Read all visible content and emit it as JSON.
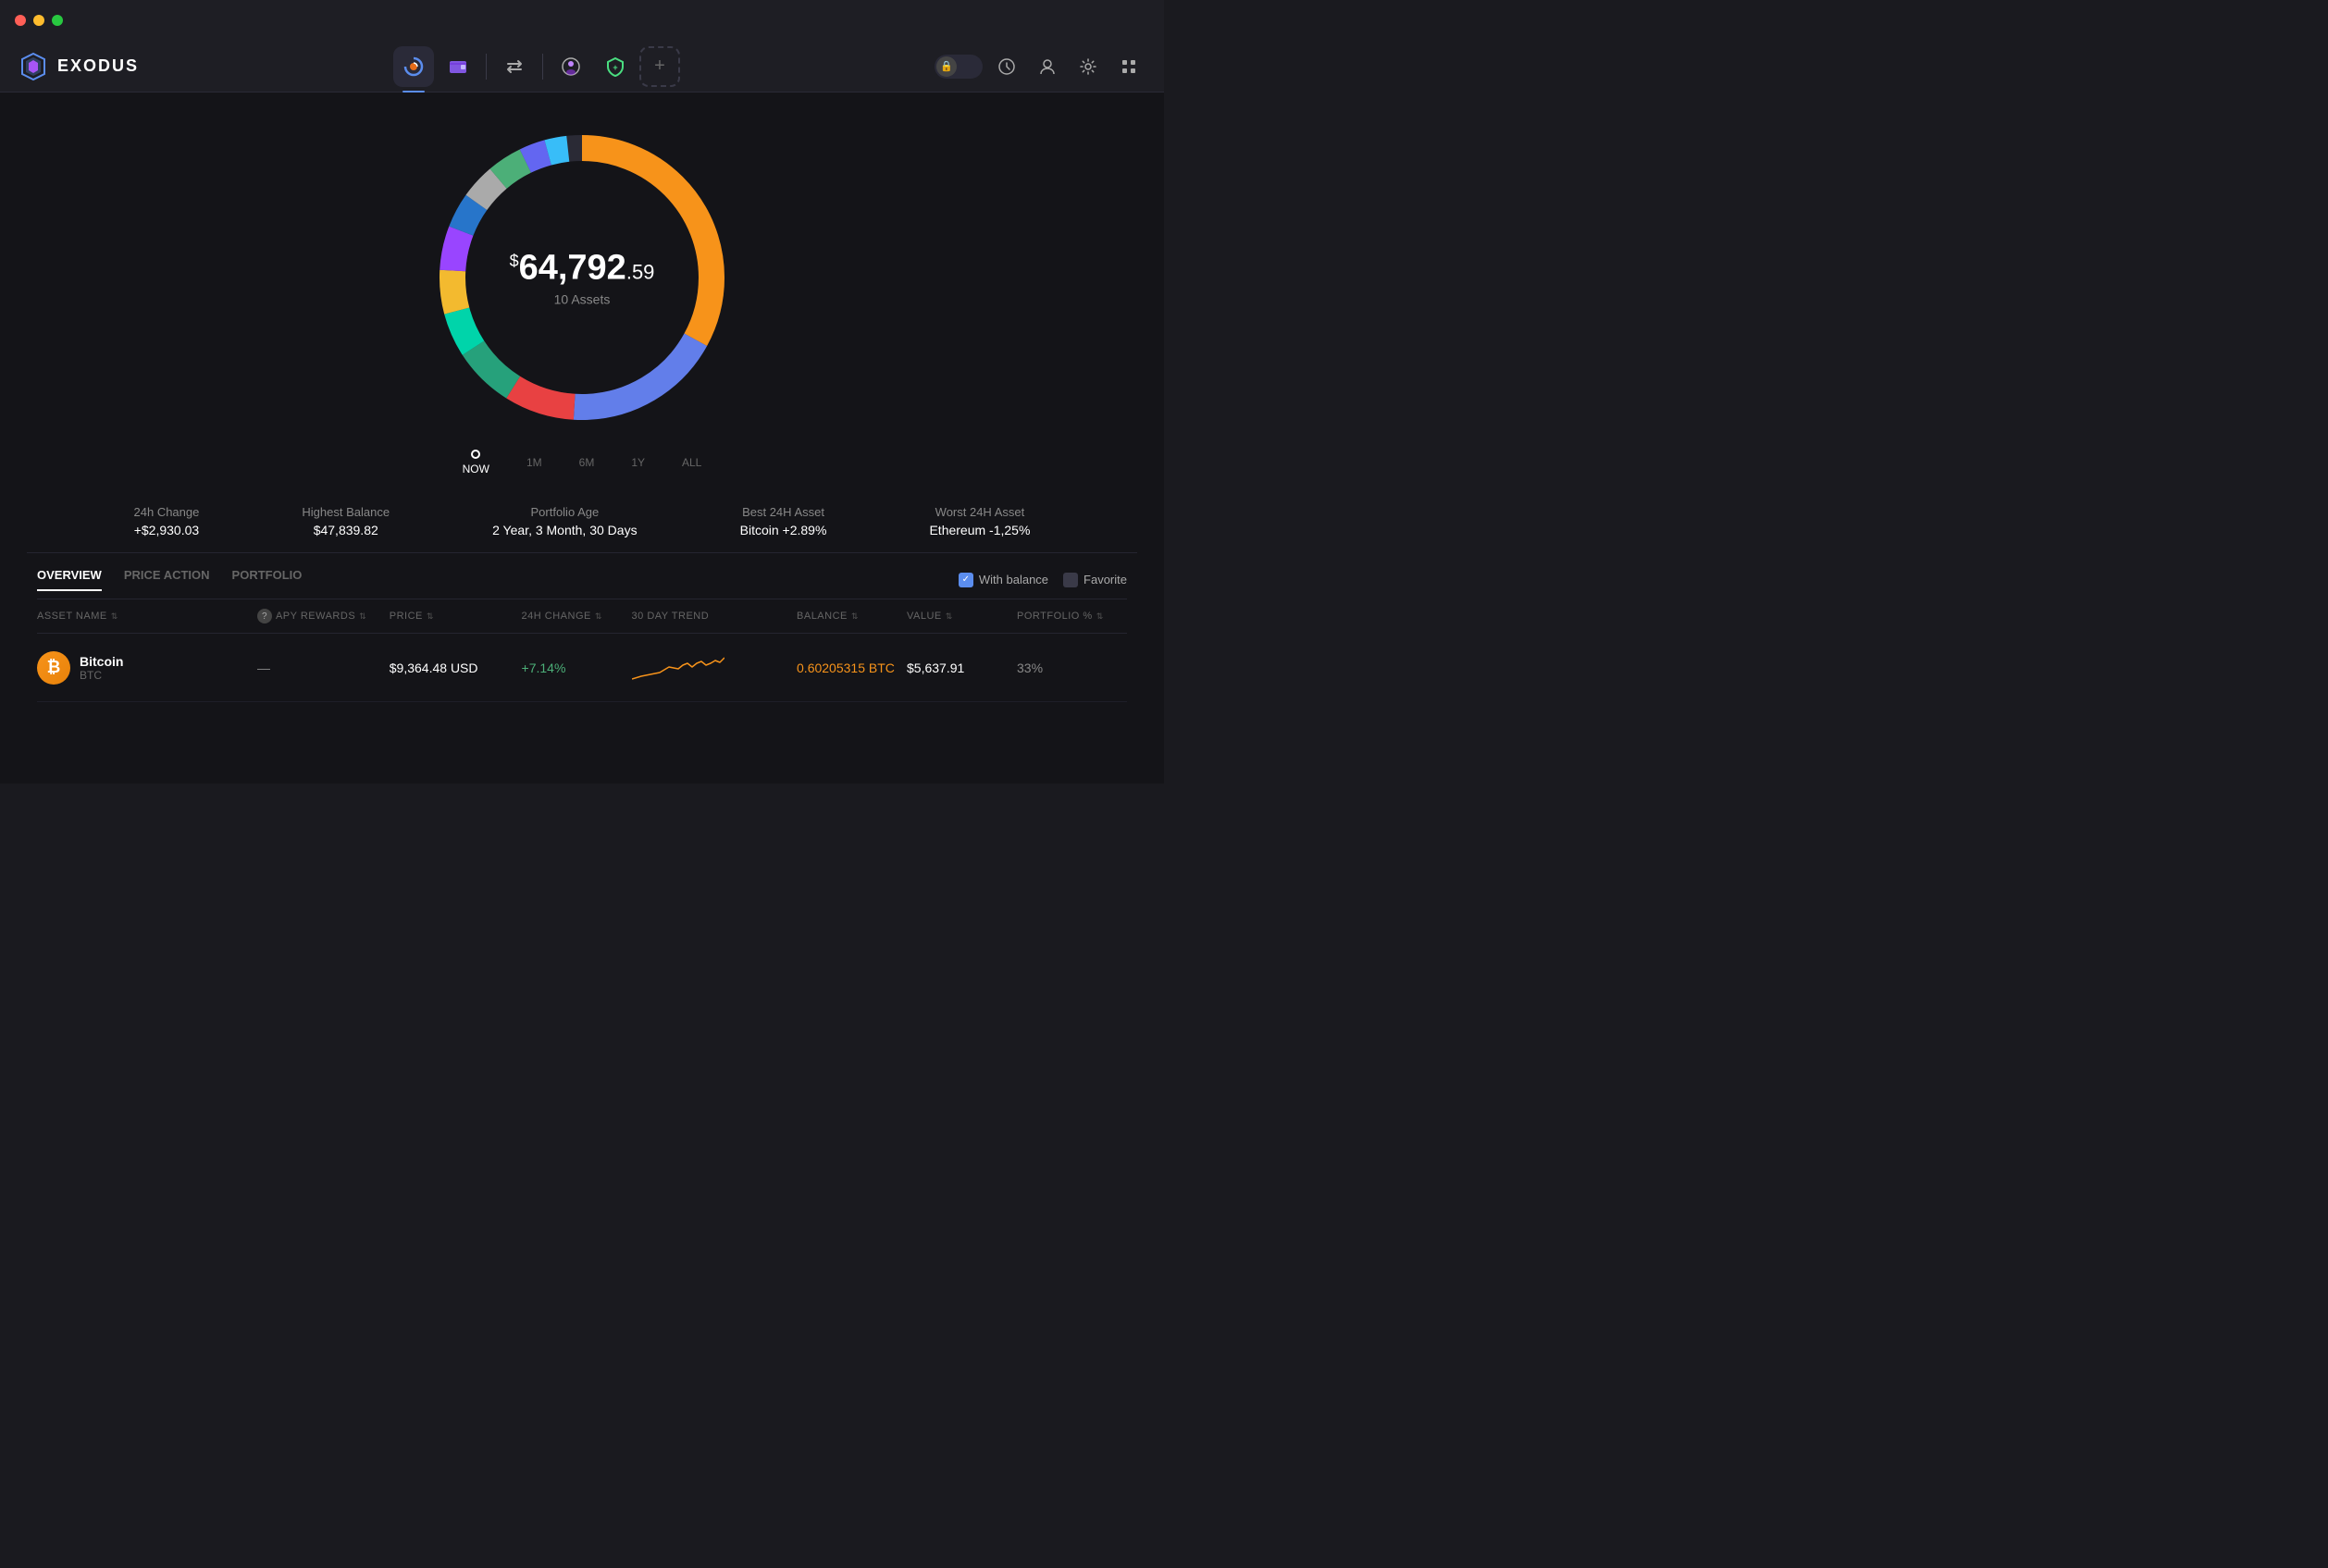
{
  "window": {
    "title": "Exodus"
  },
  "titleBar": {
    "trafficLights": [
      "close",
      "minimize",
      "maximize"
    ]
  },
  "logo": {
    "text": "EXODUS"
  },
  "nav": {
    "center": [
      {
        "id": "portfolio",
        "label": "Portfolio",
        "active": true
      },
      {
        "id": "wallet",
        "label": "Wallet"
      },
      {
        "id": "exchange",
        "label": "Exchange"
      },
      {
        "id": "nft",
        "label": "NFT"
      },
      {
        "id": "earn",
        "label": "Earn"
      },
      {
        "id": "add",
        "label": "Add"
      }
    ],
    "right": [
      {
        "id": "lock",
        "label": "Lock"
      },
      {
        "id": "history",
        "label": "History"
      },
      {
        "id": "profile",
        "label": "Profile"
      },
      {
        "id": "settings",
        "label": "Settings"
      },
      {
        "id": "grid",
        "label": "Grid"
      }
    ]
  },
  "portfolio": {
    "totalAmount": "64,792",
    "totalCents": ".59",
    "currencySymbol": "$",
    "assetCount": "10 Assets"
  },
  "timeline": [
    {
      "label": "NOW",
      "active": true
    },
    {
      "label": "1M"
    },
    {
      "label": "6M"
    },
    {
      "label": "1Y"
    },
    {
      "label": "ALL"
    }
  ],
  "stats": [
    {
      "label": "24h Change",
      "value": "+$2,930.03"
    },
    {
      "label": "Highest Balance",
      "value": "$47,839.82"
    },
    {
      "label": "Portfolio Age",
      "value": "2 Year, 3 Month, 30 Days"
    },
    {
      "label": "Best 24H Asset",
      "value": "Bitcoin +2.89%"
    },
    {
      "label": "Worst 24H Asset",
      "value": "Ethereum -1,25%"
    }
  ],
  "tabs": [
    {
      "label": "OVERVIEW",
      "active": true
    },
    {
      "label": "PRICE ACTION"
    },
    {
      "label": "PORTFOLIO"
    }
  ],
  "filters": [
    {
      "label": "With balance",
      "checked": true
    },
    {
      "label": "Favorite",
      "checked": false
    }
  ],
  "tableHeaders": [
    {
      "label": "ASSET NAME",
      "sortable": true
    },
    {
      "label": "APY REWARDS",
      "sortable": true,
      "hasHelp": true
    },
    {
      "label": "PRICE",
      "sortable": true
    },
    {
      "label": "24H CHANGE",
      "sortable": true
    },
    {
      "label": "30 DAY TREND"
    },
    {
      "label": "BALANCE",
      "sortable": true
    },
    {
      "label": "VALUE",
      "sortable": true
    },
    {
      "label": "PORTFOLIO %",
      "sortable": true
    }
  ],
  "assets": [
    {
      "name": "Bitcoin",
      "ticker": "BTC",
      "icon": "₿",
      "iconBg": "#f7931a",
      "apyRewards": "",
      "price": "$9,364.48 USD",
      "change24h": "+7.14%",
      "changePositive": true,
      "balance": "0.60205315 BTC",
      "value": "$5,637.91",
      "portfolio": "33%"
    }
  ],
  "donut": {
    "segments": [
      {
        "color": "#f7931a",
        "percentage": 33,
        "offset": 0
      },
      {
        "color": "#627eea",
        "percentage": 18,
        "offset": 33
      },
      {
        "color": "#e84142",
        "percentage": 8,
        "offset": 51
      },
      {
        "color": "#26a17b",
        "percentage": 7,
        "offset": 59
      },
      {
        "color": "#00ffa3",
        "percentage": 5,
        "offset": 66
      },
      {
        "color": "#f3ba2f",
        "percentage": 5,
        "offset": 71
      },
      {
        "color": "#9945ff",
        "percentage": 5,
        "offset": 76
      },
      {
        "color": "#2775ca",
        "percentage": 4,
        "offset": 81
      },
      {
        "color": "#aaa",
        "percentage": 4,
        "offset": 85
      },
      {
        "color": "#4caf78",
        "percentage": 4,
        "offset": 89
      },
      {
        "color": "#8247e5",
        "percentage": 3,
        "offset": 93
      }
    ]
  }
}
